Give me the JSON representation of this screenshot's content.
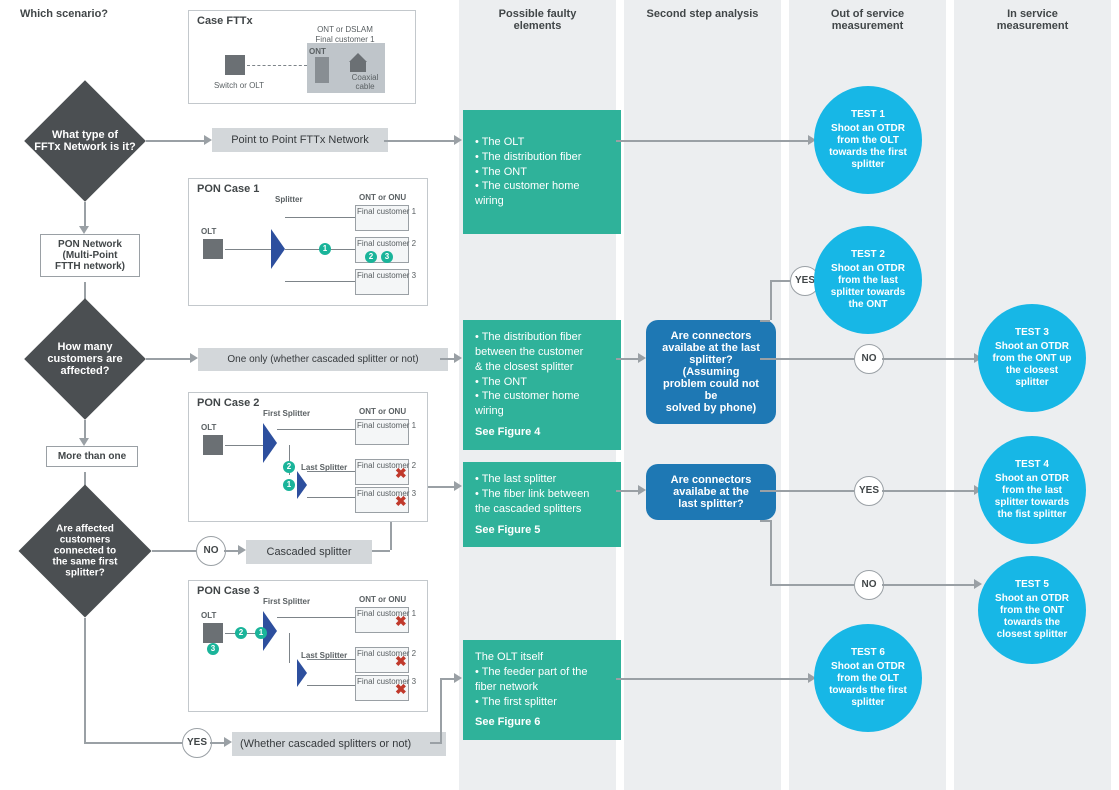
{
  "headers": {
    "scenario": "Which scenario?",
    "faulty": "Possible faulty\nelements",
    "second": "Second step analysis",
    "out": "Out of service\nmeasurement",
    "in": "In service\nmeasurement"
  },
  "decisions": {
    "d1": "What type of\nFFTx Network is it?",
    "d2": "How many\ncustomers are\naffected?",
    "d3": "Are affected\ncustomers\nconnected to\nthe same first\nsplitter?"
  },
  "labels": {
    "pon_network": "PON Network\n(Multi-Point\nFTTH network)",
    "more_than_one": "More than one",
    "p2p": "Point to Point FTTx Network",
    "one_only": "One only (whether cascaded splitter or not)",
    "cascaded": "Cascaded splitter",
    "whether": "(Whether cascaded splitters or not)",
    "no": "NO",
    "yes": "YES"
  },
  "cases": {
    "fttx": {
      "title": "Case FTTx",
      "ont_dslam": "ONT or DSLAM",
      "final_cust": "Final customer 1",
      "switch_olt": "Switch or OLT",
      "coax": "Coaxial\ncable",
      "ont": "ONT"
    },
    "p1": {
      "title": "PON Case 1",
      "splitter": "Splitter",
      "ont_onu": "ONT or ONU",
      "olt": "OLT",
      "cust": "Final customer"
    },
    "p2": {
      "title": "PON Case 2",
      "first": "First Splitter",
      "last": "Last Splitter",
      "ont_onu": "ONT or ONU",
      "olt": "OLT",
      "cust": "Final customer"
    },
    "p3": {
      "title": "PON Case 3",
      "first": "First Splitter",
      "last": "Last Splitter",
      "ont_onu": "ONT or ONU",
      "olt": "OLT",
      "cust": "Final customer"
    }
  },
  "faulty": {
    "f1": "• The OLT\n• The distribution fiber\n• The ONT\n• The customer home wiring",
    "f2": "• The distribution fiber\n  between the customer\n  & the closest splitter\n• The ONT\n• The customer home wiring",
    "f2_see": "See Figure 4",
    "f3": "• The last splitter\n• The fiber link between\n  the cascaded splitters",
    "f3_see": "See Figure 5",
    "f4": "The OLT itself\n• The feeder part of the\n  fiber network\n• The first splitter",
    "f4_see": "See Figure 6"
  },
  "second_step": {
    "s1": "Are connectors\navailabe at the last\nsplitter?\n(Assuming\nproblem could not be\nsolved by phone)",
    "s2": "Are connectors\navailabe at the\nlast splitter?"
  },
  "tests": {
    "t1": {
      "h": "TEST 1",
      "b": "Shoot an OTDR\nfrom the OLT\ntowards the first\nsplitter"
    },
    "t2": {
      "h": "TEST 2",
      "b": "Shoot an OTDR\nfrom the last\nsplitter towards\nthe ONT"
    },
    "t3": {
      "h": "TEST 3",
      "b": "Shoot an OTDR\nfrom the ONT up\nthe closest\nsplitter"
    },
    "t4": {
      "h": "TEST 4",
      "b": "Shoot an OTDR\nfrom the last\nsplitter towards\nthe fist splitter"
    },
    "t5": {
      "h": "TEST 5",
      "b": "Shoot an OTDR\nfrom the ONT\ntowards the\nclosest splitter"
    },
    "t6": {
      "h": "TEST 6",
      "b": "Shoot an OTDR\nfrom the OLT\ntowards the first\nsplitter"
    }
  }
}
